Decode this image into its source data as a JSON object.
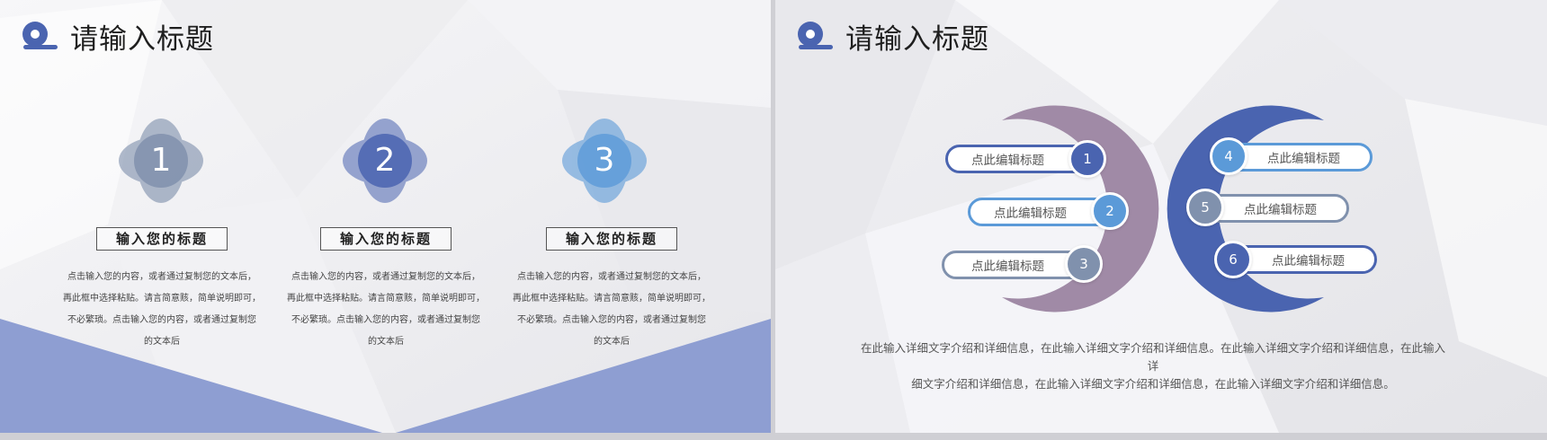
{
  "left_slide": {
    "title": "请输入标题",
    "cards": [
      {
        "number": "1",
        "heading": "输入您的标题",
        "desc_lines": [
          "点击输入您的内容，或者通过复制您的文本后，",
          "再此框中选择粘贴。请言简意赅，简单说明即可，",
          "不必繁琐。点击输入您的内容，或者通过复制您",
          "的文本后"
        ]
      },
      {
        "number": "2",
        "heading": "输入您的标题",
        "desc_lines": [
          "点击输入您的内容，或者通过复制您的文本后，",
          "再此框中选择粘贴。请言简意赅，简单说明即可，",
          "不必繁琐。点击输入您的内容，或者通过复制您",
          "的文本后"
        ]
      },
      {
        "number": "3",
        "heading": "输入您的标题",
        "desc_lines": [
          "点击输入您的内容，或者通过复制您的文本后，",
          "再此框中选择粘贴。请言简意赅，简单说明即可，",
          "不必繁琐。点击输入您的内容，或者通过复制您",
          "的文本后"
        ]
      }
    ]
  },
  "right_slide": {
    "title": "请输入标题",
    "items": [
      {
        "number": "1",
        "label": "点此编辑标题"
      },
      {
        "number": "2",
        "label": "点此编辑标题"
      },
      {
        "number": "3",
        "label": "点此编辑标题"
      },
      {
        "number": "4",
        "label": "点此编辑标题"
      },
      {
        "number": "5",
        "label": "点此编辑标题"
      },
      {
        "number": "6",
        "label": "点此编辑标题"
      }
    ],
    "description_lines": [
      "在此输入详细文字介绍和详细信息，在此输入详细文字介绍和详细信息。在此输入详细文字介绍和详细信息，在此输入详",
      "细文字介绍和详细信息，在此输入详细文字介绍和详细信息，在此输入详细文字介绍和详细信息。"
    ]
  },
  "colors": {
    "accent_blue": "#4a64b0",
    "slate": "#8091ad",
    "sky": "#5b9ad8",
    "purple_gray": "#a08aa6",
    "band": "#8e9ed2"
  }
}
